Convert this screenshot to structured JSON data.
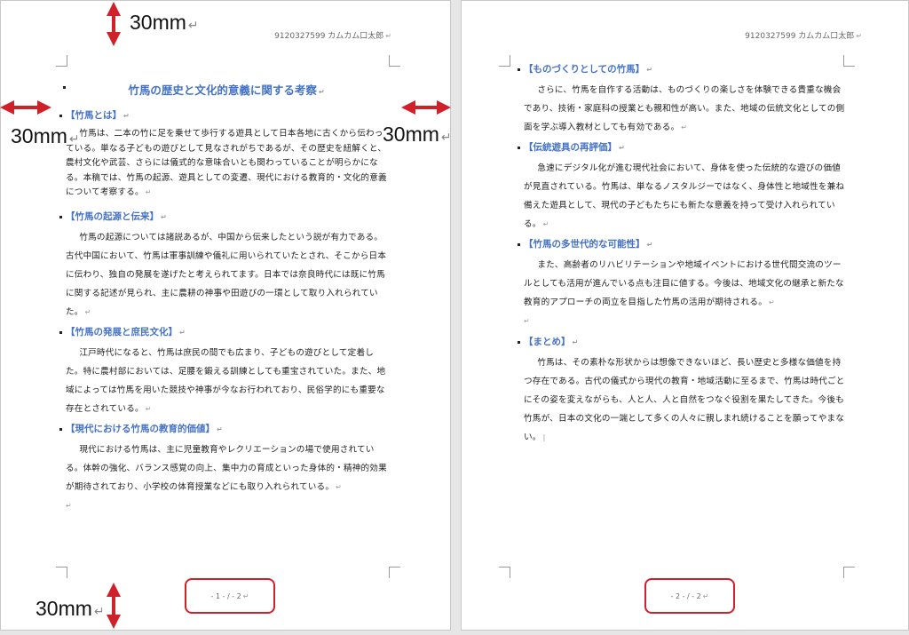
{
  "header_text": "9120327599 カムカム口太郎",
  "margin_label": "30mm",
  "return_mark": "↵",
  "page1": {
    "title": "竹馬の歴史と文化的意義に関する考察",
    "sections": [
      {
        "heading": "【竹馬とは】",
        "text": "竹馬は、二本の竹に足を乗せて歩行する遊具として日本各地に古くから伝わっている。単なる子どもの遊びとして見なされがちであるが、その歴史を紐解くと、農村文化や武芸、さらには儀式的な意味合いとも関わっていることが明らかになる。本稿では、竹馬の起源、遊具としての変遷、現代における教育的・文化的意義について考察する。"
      },
      {
        "heading": "【竹馬の起源と伝来】",
        "text": "竹馬の起源については諸説あるが、中国から伝来したという説が有力である。古代中国において、竹馬は軍事訓練や儀礼に用いられていたとされ、そこから日本に伝わり、独自の発展を遂げたと考えられてます。日本では奈良時代には既に竹馬に関する記述が見られ、主に農耕の神事や田遊びの一環として取り入れられていた。"
      },
      {
        "heading": "【竹馬の発展と庶民文化】",
        "text": "江戸時代になると、竹馬は庶民の間でも広まり、子どもの遊びとして定着した。特に農村部においては、足腰を鍛える訓練としても重宝されていた。また、地域によっては竹馬を用いた競技や神事が今なお行われており、民俗学的にも重要な存在とされている。"
      },
      {
        "heading": "【現代における竹馬の教育的価値】",
        "text": "現代における竹馬は、主に児童教育やレクリエーションの場で使用されている。体幹の強化、バランス感覚の向上、集中力の育成といった身体的・精神的効果が期待されており、小学校の体育授業などにも取り入れられている。"
      }
    ],
    "page_number": "- 1 - / - 2"
  },
  "page2": {
    "sections": [
      {
        "heading": "【ものづくりとしての竹馬】",
        "text": "さらに、竹馬を自作する活動は、ものづくりの楽しさを体験できる貴重な機会であり、技術・家庭科の授業とも親和性が高い。また、地域の伝統文化としての側面を学ぶ導入教材としても有効である。"
      },
      {
        "heading": "【伝統遊具の再評価】",
        "text": "急速にデジタル化が進む現代社会において、身体を使った伝統的な遊びの価値が見直されている。竹馬は、単なるノスタルジーではなく、身体性と地域性を兼ね備えた遊具として、現代の子どもたちにも新たな意義を持って受け入れられている。"
      },
      {
        "heading": "【竹馬の多世代的な可能性】",
        "text": "また、高齢者のリハビリテーションや地域イベントにおける世代間交流のツールとしても活用が進んでいる点も注目に値する。今後は、地域文化の継承と新たな教育的アプローチの両立を目指した竹馬の活用が期待される。"
      },
      {
        "heading": "【まとめ】",
        "text": "竹馬は、その素朴な形状からは想像できないほど、長い歴史と多様な価値を持つ存在である。古代の儀式から現代の教育・地域活動に至るまで、竹馬は時代ごとにその姿を変えながらも、人と人、人と自然をつなぐ役割を果たしてきた。今後も竹馬が、日本の文化の一端として多くの人々に親しまれ続けることを願ってやまない。"
      }
    ],
    "page_number": "- 2 - / - 2"
  },
  "colors": {
    "heading": "#4472c4",
    "annotation_red": "#d0202a"
  }
}
